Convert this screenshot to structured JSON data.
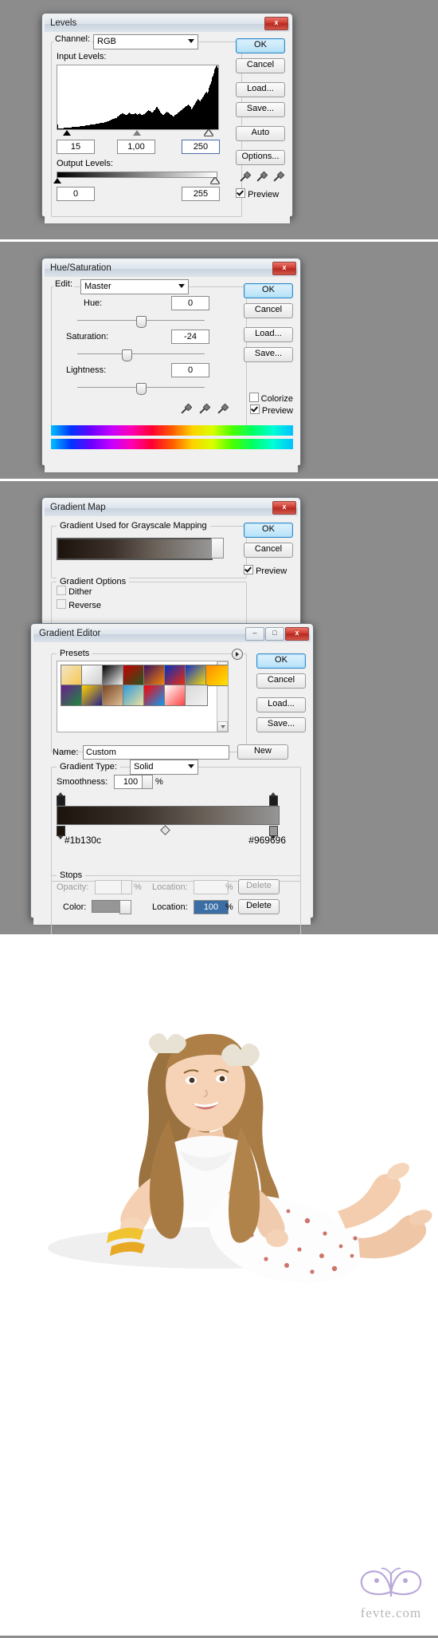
{
  "levels": {
    "title": "Levels",
    "close_label": "x",
    "channel_label": "Channel:",
    "channel_value": "RGB",
    "input_label": "Input Levels:",
    "input_black": "15",
    "input_gamma": "1,00",
    "input_white": "250",
    "output_label": "Output Levels:",
    "output_black": "0",
    "output_white": "255",
    "preview_label": "Preview",
    "buttons": [
      "OK",
      "Cancel",
      "Load...",
      "Save...",
      "Auto",
      "Options..."
    ],
    "histogram": [
      18,
      4,
      3,
      3,
      3,
      3,
      4,
      4,
      4,
      4,
      5,
      5,
      5,
      5,
      5,
      6,
      6,
      6,
      6,
      6,
      7,
      7,
      7,
      7,
      8,
      8,
      8,
      9,
      9,
      9,
      10,
      10,
      10,
      11,
      11,
      11,
      12,
      12,
      12,
      13,
      13,
      13,
      14,
      14,
      14,
      15,
      15,
      15,
      16,
      16,
      16,
      17,
      17,
      17,
      18,
      18,
      19,
      19,
      19,
      20,
      20,
      20,
      21,
      21,
      21,
      22,
      22,
      23,
      23,
      24,
      24,
      25,
      25,
      26,
      26,
      27,
      27,
      28,
      28,
      29,
      30,
      31,
      32,
      33,
      34,
      35,
      36,
      37,
      38,
      39,
      40,
      41,
      42,
      43,
      44,
      45,
      46,
      48,
      50,
      52,
      54,
      56,
      58,
      60,
      62,
      63,
      64,
      65,
      62,
      60,
      58,
      57,
      56,
      58,
      60,
      62,
      64,
      66,
      65,
      63,
      61,
      60,
      59,
      58,
      60,
      62,
      64,
      63,
      61,
      59,
      58,
      57,
      59,
      61,
      63,
      62,
      60,
      58,
      57,
      56,
      58,
      60,
      62,
      64,
      66,
      68,
      70,
      72,
      74,
      76,
      74,
      72,
      70,
      68,
      66,
      68,
      70,
      72,
      75,
      78,
      82,
      86,
      90,
      88,
      84,
      80,
      76,
      72,
      68,
      64,
      60,
      58,
      56,
      58,
      60,
      62,
      64,
      66,
      68,
      70,
      68,
      66,
      64,
      62,
      60,
      58,
      56,
      54,
      52,
      50,
      52,
      54,
      56,
      58,
      60,
      62,
      64,
      66,
      68,
      70,
      72,
      74,
      76,
      78,
      80,
      82,
      84,
      86,
      88,
      90,
      92,
      94,
      96,
      98,
      100,
      96,
      92,
      88,
      84,
      80,
      84,
      88,
      92,
      96,
      100,
      104,
      108,
      112,
      116,
      120,
      118,
      116,
      114,
      112,
      115,
      118,
      122,
      126,
      130,
      134,
      138,
      142,
      146,
      150,
      146,
      142,
      150,
      158,
      166,
      174,
      182,
      190,
      198,
      206,
      214,
      222,
      230,
      238,
      246,
      252,
      255,
      250,
      244
    ]
  },
  "huesat": {
    "title": "Hue/Saturation",
    "close_label": "x",
    "edit_label": "Edit:",
    "edit_value": "Master",
    "hue_label": "Hue:",
    "hue_value": "0",
    "saturation_label": "Saturation:",
    "saturation_value": "-24",
    "lightness_label": "Lightness:",
    "lightness_value": "0",
    "colorize_label": "Colorize",
    "preview_label": "Preview",
    "buttons": [
      "OK",
      "Cancel",
      "Load...",
      "Save..."
    ]
  },
  "gradientmap": {
    "title": "Gradient Map",
    "close_label": "x",
    "group_label": "Gradient Used for Grayscale Mapping",
    "options_label": "Gradient Options",
    "dither_label": "Dither",
    "reverse_label": "Reverse",
    "preview_label": "Preview",
    "buttons": [
      "OK",
      "Cancel"
    ],
    "gradient_from": "#1b130c",
    "gradient_to": "#969696"
  },
  "gradienteditor": {
    "title": "Gradient Editor",
    "minimize_label": "–",
    "maximize_label": "□",
    "close_label": "x",
    "presets_label": "Presets",
    "name_label": "Name:",
    "name_value": "Custom",
    "new_label": "New",
    "type_label": "Gradient Type:",
    "type_value": "Solid",
    "smoothness_label": "Smoothness:",
    "smoothness_value": "100",
    "smoothness_unit": "%",
    "stops_label": "Stops",
    "opacity_label": "Opacity:",
    "opacity_value": "",
    "opacity_unit": "%",
    "location_label": "Location:",
    "location_value_top": "",
    "location_unit": "%",
    "delete_label": "Delete",
    "color_label": "Color:",
    "location_label_2": "Location:",
    "location_value": "100",
    "buttons": [
      "OK",
      "Cancel",
      "Load...",
      "Save..."
    ],
    "stop_left_hex": "#1b130c",
    "stop_right_hex": "#969696",
    "preset_colors": [
      [
        "#f2e6c8",
        "#f7c64a"
      ],
      [
        "#ffffff",
        "#c9c9c9"
      ],
      [
        "#000000",
        "#ffffff"
      ],
      [
        "#c40000",
        "#1d5c1d"
      ],
      [
        "#3a1060",
        "#ff8a00"
      ],
      [
        "#0030c0",
        "#ff2a00"
      ],
      [
        "#1030c8",
        "#ffe400"
      ],
      [
        "#ff8a00",
        "#ffe400"
      ],
      [
        "#6a1d8e",
        "#1d8e3a"
      ],
      [
        "#ffd000",
        "#1d1d8e"
      ],
      [
        "#7a4422",
        "#e0c49a"
      ],
      [
        "#2a9bdc",
        "#f7e39a"
      ],
      [
        "#ff0000",
        "#00a2ff"
      ],
      [
        "#ffffff",
        "#ff3a3a"
      ],
      [
        "#d8d8d8",
        "#f2f2f2"
      ]
    ]
  },
  "watermark": {
    "text": "fevte.com"
  }
}
